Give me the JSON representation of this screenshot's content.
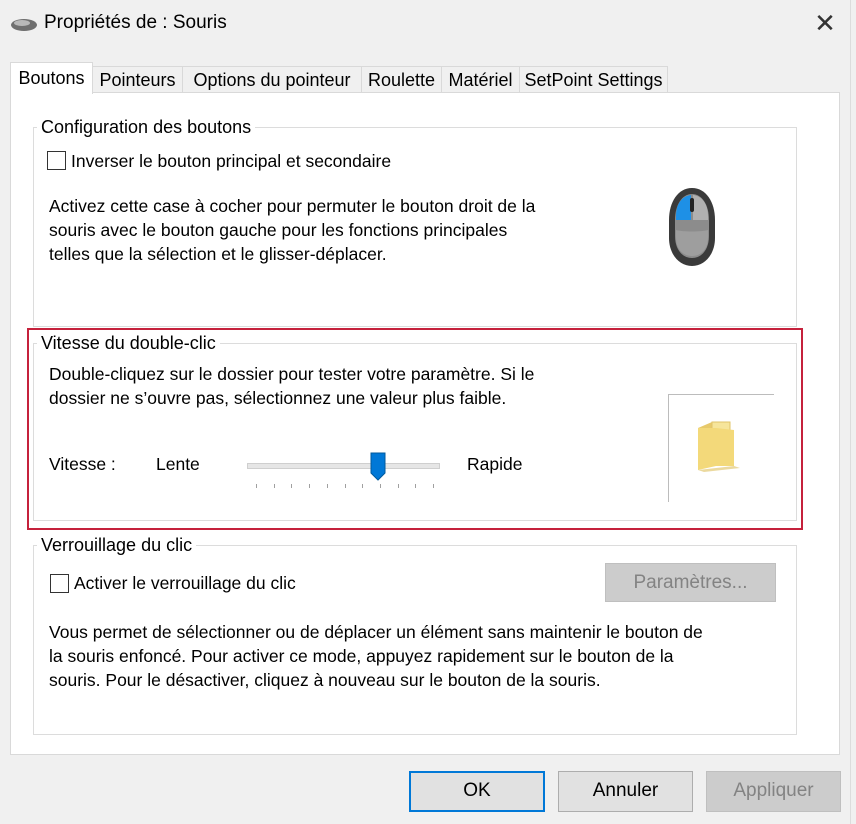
{
  "window": {
    "title": "Propriétés de : Souris"
  },
  "icons": {
    "app": "mouse-icon",
    "close": "close-icon",
    "mouse_illustration": "mouse-illustration-icon",
    "folder": "folder-icon"
  },
  "tabs": [
    "Boutons",
    "Pointeurs",
    "Options du pointeur",
    "Roulette",
    "Matériel",
    "SetPoint Settings"
  ],
  "button_config": {
    "title": "Configuration des boutons",
    "swap_label": "Inverser le bouton principal et secondaire",
    "swap_checked": false,
    "description": [
      "Activez cette case à cocher pour permuter le bouton droit de la",
      "souris avec le bouton gauche pour les fonctions principales",
      "telles que la sélection et le glisser-déplacer."
    ]
  },
  "double_click": {
    "title": "Vitesse du double-clic",
    "description": [
      "Double-cliquez sur le dossier pour tester votre paramètre. Si le",
      "dossier ne s’ouvre pas, sélectionnez une valeur plus faible."
    ],
    "speed_label": "Vitesse :",
    "slow_label": "Lente",
    "fast_label": "Rapide",
    "slider_value_fraction": 0.68
  },
  "click_lock": {
    "title": "Verrouillage du clic",
    "enable_label": "Activer le verrouillage du clic",
    "enable_checked": false,
    "settings_button": "Paramètres...",
    "description": [
      "Vous permet de sélectionner ou de déplacer un élément sans maintenir le bouton de",
      "la souris enfoncé. Pour activer ce mode, appuyez rapidement sur le bouton de la",
      "souris. Pour le désactiver, cliquez à nouveau sur le bouton de la souris."
    ]
  },
  "footer": {
    "ok": "OK",
    "cancel": "Annuler",
    "apply": "Appliquer"
  },
  "colors": {
    "highlight": "#c5213c",
    "accent": "#0078d7"
  }
}
